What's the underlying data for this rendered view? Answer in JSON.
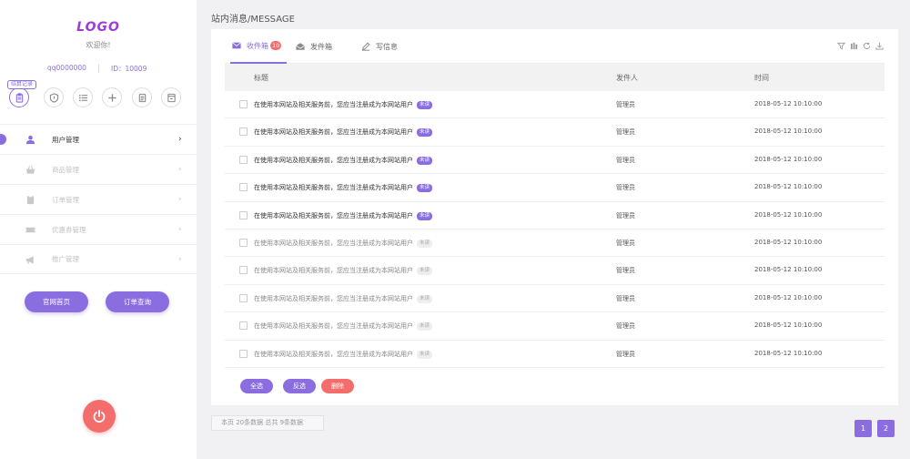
{
  "colors": {
    "accent": "#8a6ee0",
    "danger": "#f46d6d",
    "logo": "#a03bd8"
  },
  "sidebar": {
    "logo": "LOGO",
    "welcome": "欢迎你!",
    "qq": "qq0000000",
    "user_id": "ID：10009",
    "quick_badge": "结算记录",
    "quick_icons": [
      "clipboard-icon",
      "shield-icon",
      "list-icon",
      "plus-icon",
      "document-icon",
      "archive-icon"
    ],
    "menu": [
      {
        "label": "用户管理",
        "icon": "user-icon",
        "active": true
      },
      {
        "label": "商品管理",
        "icon": "basket-icon",
        "active": false
      },
      {
        "label": "订单管理",
        "icon": "clipboard-icon",
        "active": false
      },
      {
        "label": "优惠券管理",
        "icon": "ticket-icon",
        "active": false
      },
      {
        "label": "推广管理",
        "icon": "megaphone-icon",
        "active": false
      }
    ],
    "buttons": {
      "home": "官网首页",
      "orders": "订单查询"
    },
    "power_icon": "power-icon"
  },
  "page": {
    "title": "站内消息/MESSAGE"
  },
  "tabs": [
    {
      "label": "收件箱",
      "badge": "10",
      "icon": "envelope-icon",
      "active": true
    },
    {
      "label": "发件箱",
      "badge": "",
      "icon": "open-envelope-icon",
      "active": false
    },
    {
      "label": "写信息",
      "badge": "",
      "icon": "pen-icon",
      "active": false
    }
  ],
  "tools": [
    "filter-icon",
    "columns-icon",
    "refresh-icon",
    "download-icon"
  ],
  "table": {
    "headers": {
      "subject": "标题",
      "sender": "发件人",
      "time": "时间"
    },
    "rows": [
      {
        "subject": "在使用本网站及相关服务前，您应当注册成为本网站用户",
        "status": "未读",
        "unread": true,
        "sender": "管理员",
        "time": "2018-05-12   10:10:00"
      },
      {
        "subject": "在使用本网站及相关服务前，您应当注册成为本网站用户",
        "status": "未读",
        "unread": true,
        "sender": "管理员",
        "time": "2018-05-12   10:10:00"
      },
      {
        "subject": "在使用本网站及相关服务前，您应当注册成为本网站用户",
        "status": "未读",
        "unread": true,
        "sender": "管理员",
        "time": "2018-05-12   10:10:00"
      },
      {
        "subject": "在使用本网站及相关服务前，您应当注册成为本网站用户",
        "status": "未读",
        "unread": true,
        "sender": "管理员",
        "time": "2018-05-12   10:10:00"
      },
      {
        "subject": "在使用本网站及相关服务前，您应当注册成为本网站用户",
        "status": "未读",
        "unread": true,
        "sender": "管理员",
        "time": "2018-05-12   10:10:00"
      },
      {
        "subject": "在使用本网站及相关服务前，您应当注册成为本网站用户",
        "status": "未读",
        "unread": false,
        "sender": "管理员",
        "time": "2018-05-12   10:10:00"
      },
      {
        "subject": "在使用本网站及相关服务前，您应当注册成为本网站用户",
        "status": "未读",
        "unread": false,
        "sender": "管理员",
        "time": "2018-05-12   10:10:00"
      },
      {
        "subject": "在使用本网站及相关服务前，您应当注册成为本网站用户",
        "status": "未读",
        "unread": false,
        "sender": "管理员",
        "time": "2018-05-12   10:10:00"
      },
      {
        "subject": "在使用本网站及相关服务前，您应当注册成为本网站用户",
        "status": "未读",
        "unread": false,
        "sender": "管理员",
        "time": "2018-05-12   10:10:00"
      },
      {
        "subject": "在使用本网站及相关服务前，您应当注册成为本网站用户",
        "status": "未读",
        "unread": false,
        "sender": "管理员",
        "time": "2018-05-12   10:10:00"
      }
    ]
  },
  "actions": {
    "select_all": "全选",
    "invert": "反选",
    "delete": "删除"
  },
  "pagination": {
    "info": "本页   20条数据  总共   9条数据",
    "pages": [
      "1",
      "2"
    ]
  }
}
